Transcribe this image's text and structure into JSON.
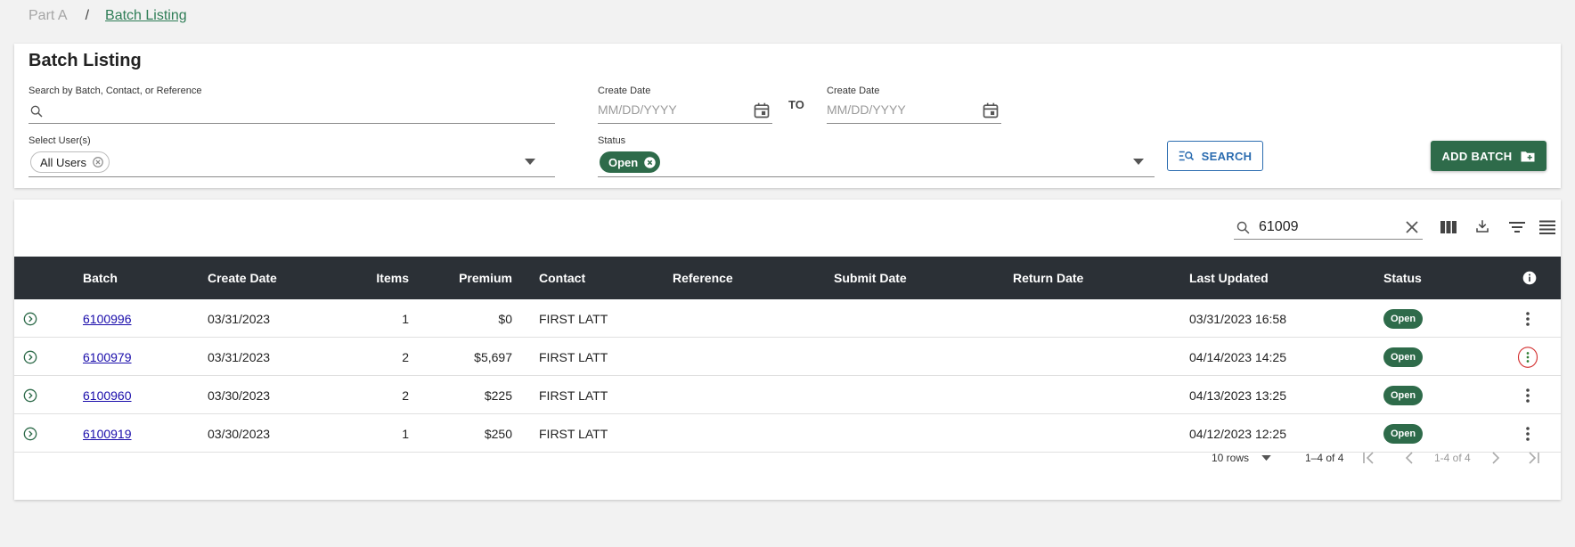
{
  "breadcrumb": {
    "parent": "Part A",
    "separator": "/",
    "current": "Batch Listing"
  },
  "filters": {
    "title": "Batch Listing",
    "search_label": "Search by Batch, Contact, or Reference",
    "create_date_from_label": "Create Date",
    "create_date_from_placeholder": "MM/DD/YYYY",
    "to_label": "TO",
    "create_date_to_label": "Create Date",
    "create_date_to_placeholder": "MM/DD/YYYY",
    "users_label": "Select User(s)",
    "users_chip": "All Users",
    "status_label": "Status",
    "status_chip": "Open",
    "search_button": "SEARCH",
    "add_batch_button": "ADD BATCH"
  },
  "table": {
    "search_value": "61009",
    "columns": {
      "batch": "Batch",
      "create_date": "Create Date",
      "items": "Items",
      "premium": "Premium",
      "contact": "Contact",
      "reference": "Reference",
      "submit_date": "Submit Date",
      "return_date": "Return Date",
      "last_updated": "Last Updated",
      "status": "Status"
    },
    "rows": [
      {
        "batch": "6100996",
        "create_date": "03/31/2023",
        "items": "1",
        "premium": "$0",
        "contact": "FIRST LATT",
        "reference": "",
        "submit_date": "",
        "return_date": "",
        "last_updated": "03/31/2023 16:58",
        "status": "Open"
      },
      {
        "batch": "6100979",
        "create_date": "03/31/2023",
        "items": "2",
        "premium": "$5,697",
        "contact": "FIRST LATT",
        "reference": "",
        "submit_date": "",
        "return_date": "",
        "last_updated": "04/14/2023 14:25",
        "status": "Open"
      },
      {
        "batch": "6100960",
        "create_date": "03/30/2023",
        "items": "2",
        "premium": "$225",
        "contact": "FIRST LATT",
        "reference": "",
        "submit_date": "",
        "return_date": "",
        "last_updated": "04/13/2023 13:25",
        "status": "Open"
      },
      {
        "batch": "6100919",
        "create_date": "03/30/2023",
        "items": "1",
        "premium": "$250",
        "contact": "FIRST LATT",
        "reference": "",
        "submit_date": "",
        "return_date": "",
        "last_updated": "04/12/2023 12:25",
        "status": "Open"
      }
    ],
    "footer": {
      "rows_per_page": "10 rows",
      "range_left": "1–4 of 4",
      "range_right": "1-4 of 4"
    }
  },
  "colors": {
    "accent_green": "#2e6b4a",
    "header_dark": "#2b3036",
    "link_blue": "#1a0dab",
    "highlight_red": "#d32f2f"
  },
  "icons": [
    "search-icon",
    "calendar-icon",
    "chevron-down-icon",
    "clear-icon",
    "columns-icon",
    "download-icon",
    "filter-icon",
    "density-icon",
    "info-icon",
    "expand-row-icon",
    "more-vert-icon",
    "first-page-icon",
    "prev-page-icon",
    "next-page-icon",
    "last-page-icon",
    "folder-add-icon"
  ]
}
